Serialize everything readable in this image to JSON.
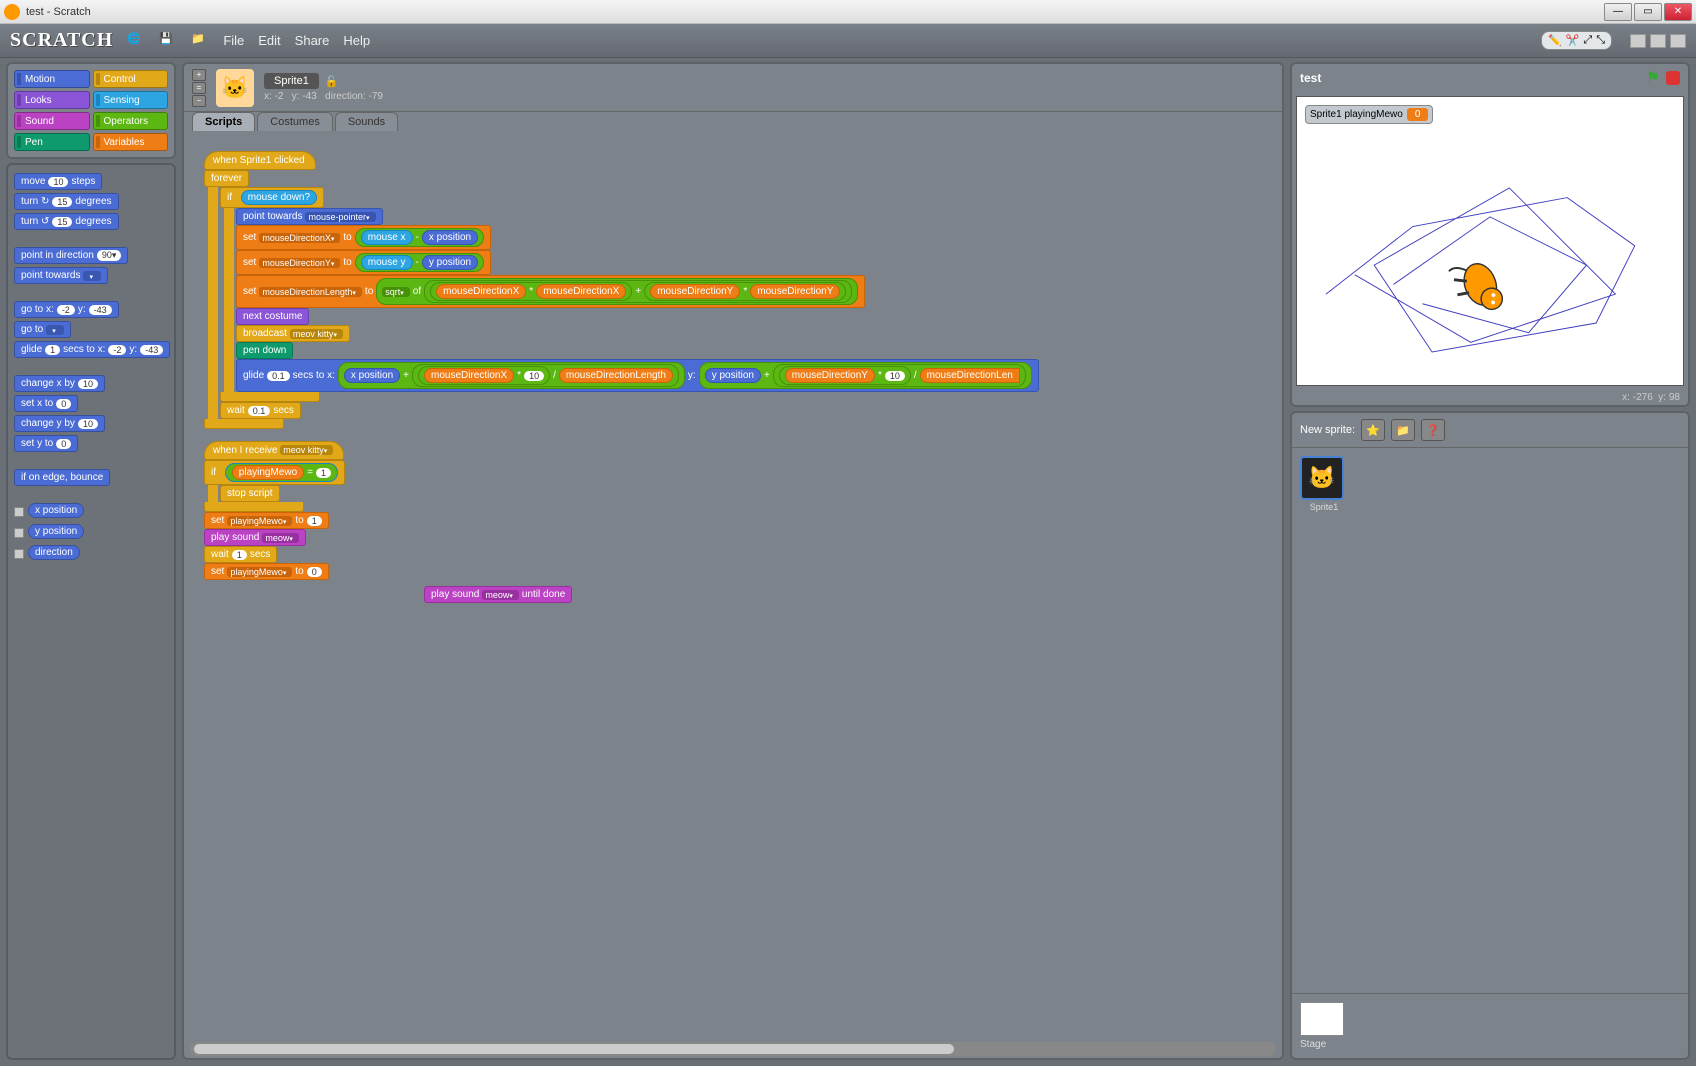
{
  "window": {
    "title": "test - Scratch"
  },
  "menubar": {
    "logo": "SCRATCH",
    "items": [
      "File",
      "Edit",
      "Share",
      "Help"
    ]
  },
  "categories": {
    "motion": "Motion",
    "control": "Control",
    "looks": "Looks",
    "sensing": "Sensing",
    "sound": "Sound",
    "operators": "Operators",
    "pen": "Pen",
    "variables": "Variables"
  },
  "palette": {
    "move": {
      "pre": "move",
      "val": "10",
      "post": "steps"
    },
    "turncw": {
      "pre": "turn ↻",
      "val": "15",
      "post": "degrees"
    },
    "turnccw": {
      "pre": "turn ↺",
      "val": "15",
      "post": "degrees"
    },
    "pointdir": {
      "pre": "point in direction",
      "val": "90▾"
    },
    "pointtowards": {
      "pre": "point towards",
      "dd": ""
    },
    "gotoxy": {
      "pre": "go to x:",
      "x": "-2",
      "mid": "y:",
      "y": "-43"
    },
    "goto": {
      "pre": "go to",
      "dd": ""
    },
    "glide": {
      "pre": "glide",
      "s": "1",
      "mid1": "secs to x:",
      "x": "-2",
      "mid2": "y:",
      "y": "-43"
    },
    "changex": {
      "pre": "change x by",
      "val": "10"
    },
    "setx": {
      "pre": "set x to",
      "val": "0"
    },
    "changey": {
      "pre": "change y by",
      "val": "10"
    },
    "sety": {
      "pre": "set y to",
      "val": "0"
    },
    "bounce": {
      "text": "if on edge, bounce"
    },
    "rep_x": "x position",
    "rep_y": "y position",
    "rep_dir": "direction"
  },
  "sprite": {
    "name": "Sprite1",
    "x": "-2",
    "y": "-43",
    "dir": "-79",
    "lock": "🔓"
  },
  "tabs": {
    "scripts": "Scripts",
    "costumes": "Costumes",
    "sounds": "Sounds"
  },
  "script1": {
    "hat": "when Sprite1 clicked",
    "forever": "forever",
    "if": "if",
    "mousedown": "mouse down?",
    "pointtowards": "point towards",
    "mousepointer": "mouse-pointer",
    "set": "set",
    "to": "to",
    "mdx": "mouseDirectionX",
    "mdy": "mouseDirectionY",
    "mdl": "mouseDirectionLength",
    "mousex": "mouse x",
    "mousey": "mouse y",
    "xpos": "x position",
    "ypos": "y position",
    "sqrt": "sqrt",
    "of": "of",
    "minus": "-",
    "plus": "+",
    "times": "*",
    "div": "/",
    "nextcostume": "next costume",
    "broadcast": "broadcast",
    "meowkitty": "meov kitty",
    "pendown": "pen down",
    "glide": "glide",
    "glideval": "0.1",
    "secstox": "secs to x:",
    "y": "y:",
    "ten": "10",
    "wait": "wait",
    "waitval": "0.1",
    "secs": "secs"
  },
  "script2": {
    "hat": "when I receive",
    "msg": "meov kitty",
    "if": "if",
    "eq": "=",
    "one": "1",
    "zero": "0",
    "playingMewo": "playingMewo",
    "stopscript": "stop script",
    "set": "set",
    "to": "to",
    "playsound": "play sound",
    "meow": "meow",
    "wait": "wait",
    "waitval": "1",
    "secs": "secs"
  },
  "orphan": {
    "playsound": "play sound",
    "meow": "meow",
    "untildone": "until done"
  },
  "stage": {
    "title": "test",
    "monitor_label": "Sprite1 playingMewo",
    "monitor_value": "0",
    "coords_x": "-276",
    "coords_y": "98"
  },
  "spritelist": {
    "newsprite": "New sprite:",
    "sprite1": "Sprite1",
    "stage": "Stage"
  }
}
